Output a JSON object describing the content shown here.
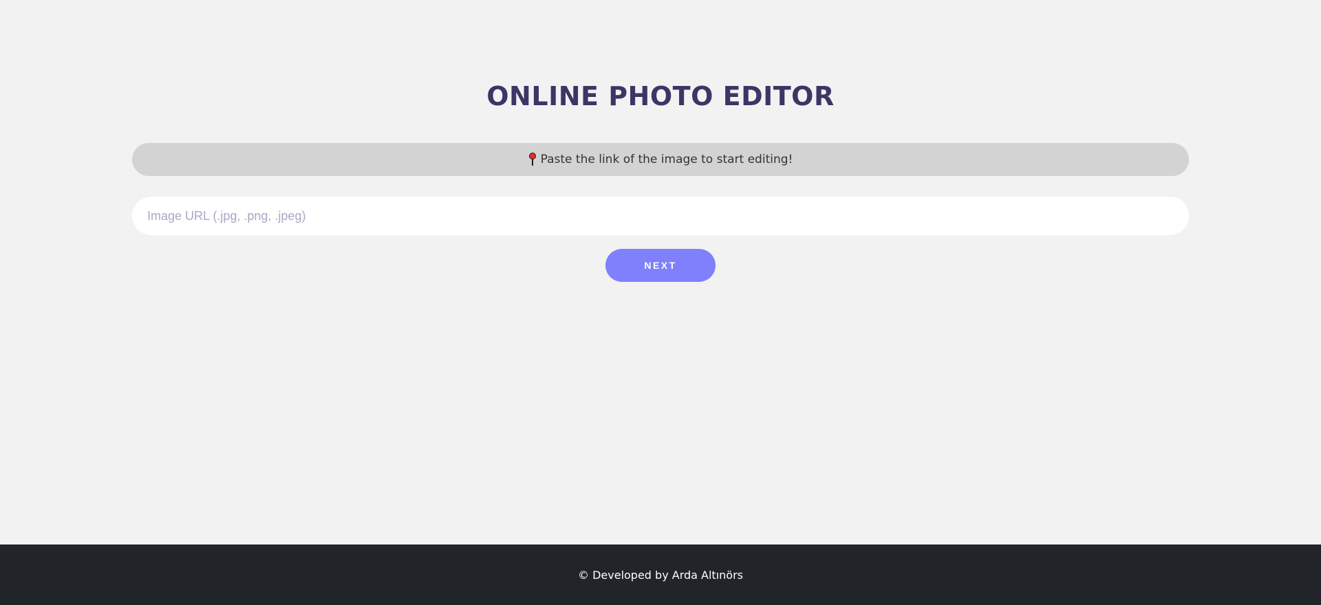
{
  "header": {
    "title": "ONLINE PHOTO EDITOR"
  },
  "hint": {
    "icon": "pushpin-icon",
    "text": "Paste the link of the image to start editing!"
  },
  "url_input": {
    "placeholder": "Image URL (.jpg, .png, .jpeg)",
    "value": ""
  },
  "next_button": {
    "label": "NEXT"
  },
  "footer": {
    "text": "© Developed by Arda Altınörs"
  },
  "colors": {
    "background": "#f2f2f2",
    "title": "#3d3565",
    "hint_background": "#d3d3d3",
    "button": "#8080fc",
    "footer_background": "#212429"
  }
}
